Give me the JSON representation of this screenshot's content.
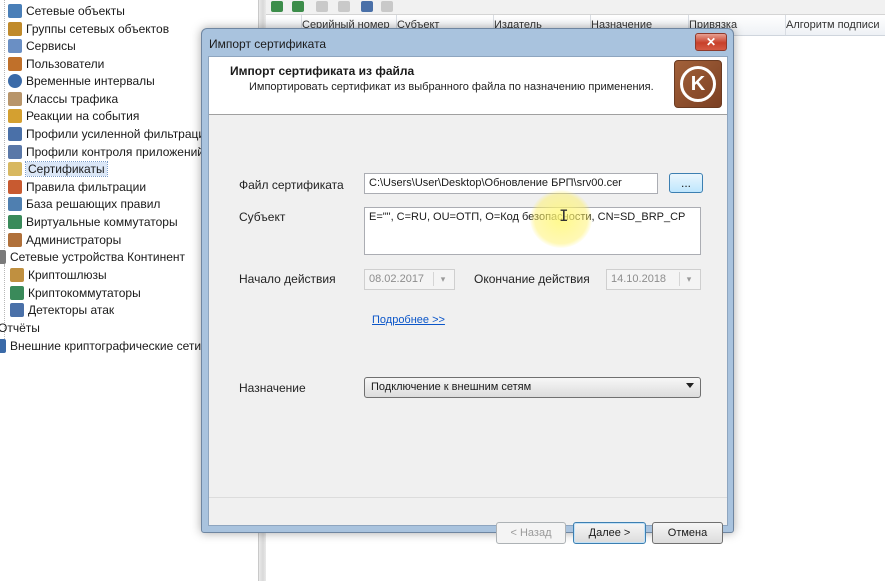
{
  "tree": {
    "items": [
      {
        "label": "Сетевые объекты",
        "icon": "network-objects-icon",
        "color": "#4a7fb8"
      },
      {
        "label": "Группы сетевых объектов",
        "icon": "network-groups-icon",
        "color": "#c08a2a"
      },
      {
        "label": "Сервисы",
        "icon": "services-icon",
        "color": "#6a8fc4"
      },
      {
        "label": "Пользователи",
        "icon": "users-icon",
        "color": "#c0702a"
      },
      {
        "label": "Временные интервалы",
        "icon": "clock-icon",
        "color": "#3a6aa8"
      },
      {
        "label": "Классы трафика",
        "icon": "traffic-classes-icon",
        "color": "#b8956a"
      },
      {
        "label": "Реакции на события",
        "icon": "bell-icon",
        "color": "#d4a030"
      },
      {
        "label": "Профили усиленной фильтрации",
        "icon": "filter-profile-icon",
        "color": "#4a70a8"
      },
      {
        "label": "Профили контроля приложений",
        "icon": "app-control-icon",
        "color": "#5a78a8"
      },
      {
        "label": "Сертификаты",
        "icon": "certificates-icon",
        "color": "#d8b860"
      },
      {
        "label": "Правила фильтрации",
        "icon": "filter-rules-icon",
        "color": "#c85a30"
      },
      {
        "label": "База решающих правил",
        "icon": "rules-base-icon",
        "color": "#4f7fb0"
      },
      {
        "label": "Виртуальные коммутаторы",
        "icon": "virtual-switch-icon",
        "color": "#3a8a5a"
      },
      {
        "label": "Администраторы",
        "icon": "admins-icon",
        "color": "#b0703a"
      },
      {
        "label": "Сетевые устройства Континент",
        "icon": "network-devices-icon",
        "color": "#7a7a7a"
      },
      {
        "label": "Криптошлюзы",
        "icon": "crypto-gateway-icon",
        "color": "#c09040"
      },
      {
        "label": "Криптокоммутаторы",
        "icon": "crypto-switch-icon",
        "color": "#3a8a5a"
      },
      {
        "label": "Детекторы атак",
        "icon": "attack-detector-icon",
        "color": "#4a70a8"
      },
      {
        "label": "Отчёты",
        "icon": "",
        "color": ""
      },
      {
        "label": "Внешние криптографические сети",
        "icon": "external-crypto-icon",
        "color": "#3a6aa8"
      }
    ]
  },
  "list": {
    "columns": [
      "Серийный номер",
      "Субъект",
      "Издатель",
      "Назначение",
      "Привязка",
      "Алгоритм подписи"
    ]
  },
  "dialog": {
    "window_title": "Импорт сертификата",
    "close_glyph": "✕",
    "header_title": "Импорт сертификата из файла",
    "header_subtitle": "Импортировать сертификат из выбранного файла по назначению применения.",
    "logo_glyph": "K",
    "file_label": "Файл сертификата",
    "file_value": "C:\\Users\\User\\Desktop\\Обновление БРП\\srv00.cer",
    "browse_label": "...",
    "subject_label": "Субъект",
    "subject_value": "E=\"\", C=RU, OU=ОТП, O=Код безопасности, CN=SD_BRP_CP",
    "start_label": "Начало действия",
    "start_value": "08.02.2017",
    "end_label": "Окончание действия",
    "end_value": "14.10.2018",
    "more_link": "Подробнее >>",
    "purpose_label": "Назначение",
    "purpose_value": "Подключение к внешним сетям",
    "back_button": "< Назад",
    "next_button": "Далее >",
    "cancel_button": "Отмена"
  }
}
